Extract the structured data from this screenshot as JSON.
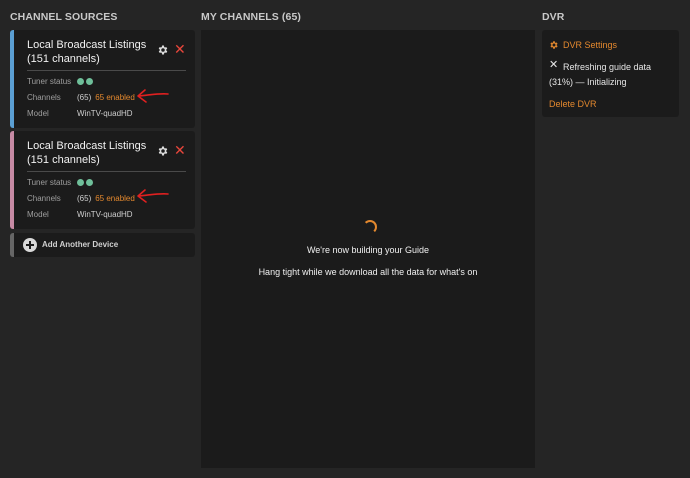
{
  "columns": {
    "sources_title": "CHANNEL SOURCES",
    "channels_title": "MY CHANNELS (65)",
    "dvr_title": "DVR"
  },
  "sources": [
    {
      "name": "Local Broadcast Listings",
      "name_count": "(151 channels)",
      "tuner_label": "Tuner status",
      "channels_label": "Channels",
      "channels_count": "(65)",
      "enabled_text": "65 enabled",
      "model_label": "Model",
      "model_value": "WinTV-quadHD",
      "accent_color": "#5b9fd3"
    },
    {
      "name": "Local Broadcast Listings",
      "name_count": "(151 channels)",
      "tuner_label": "Tuner status",
      "channels_label": "Channels",
      "channels_count": "(65)",
      "enabled_text": "65 enabled",
      "model_label": "Model",
      "model_value": "WinTV-quadHD",
      "accent_color": "#c68aa4"
    }
  ],
  "add_device": {
    "label": "Add Another Device",
    "icon": "plus-circle-icon"
  },
  "channels": {
    "building_text": "We're now building your Guide",
    "hang_text": "Hang tight while we download all the data for what's on"
  },
  "dvr": {
    "settings_label": "DVR Settings",
    "refresh_text": "Refreshing guide data",
    "progress_text": "(31%) — Initializing",
    "delete_label": "Delete DVR"
  },
  "colors": {
    "accent_orange": "#e3882e",
    "danger_red": "#e8463b",
    "status_green": "#6fbf9a",
    "annotation_red": "#e02020"
  }
}
